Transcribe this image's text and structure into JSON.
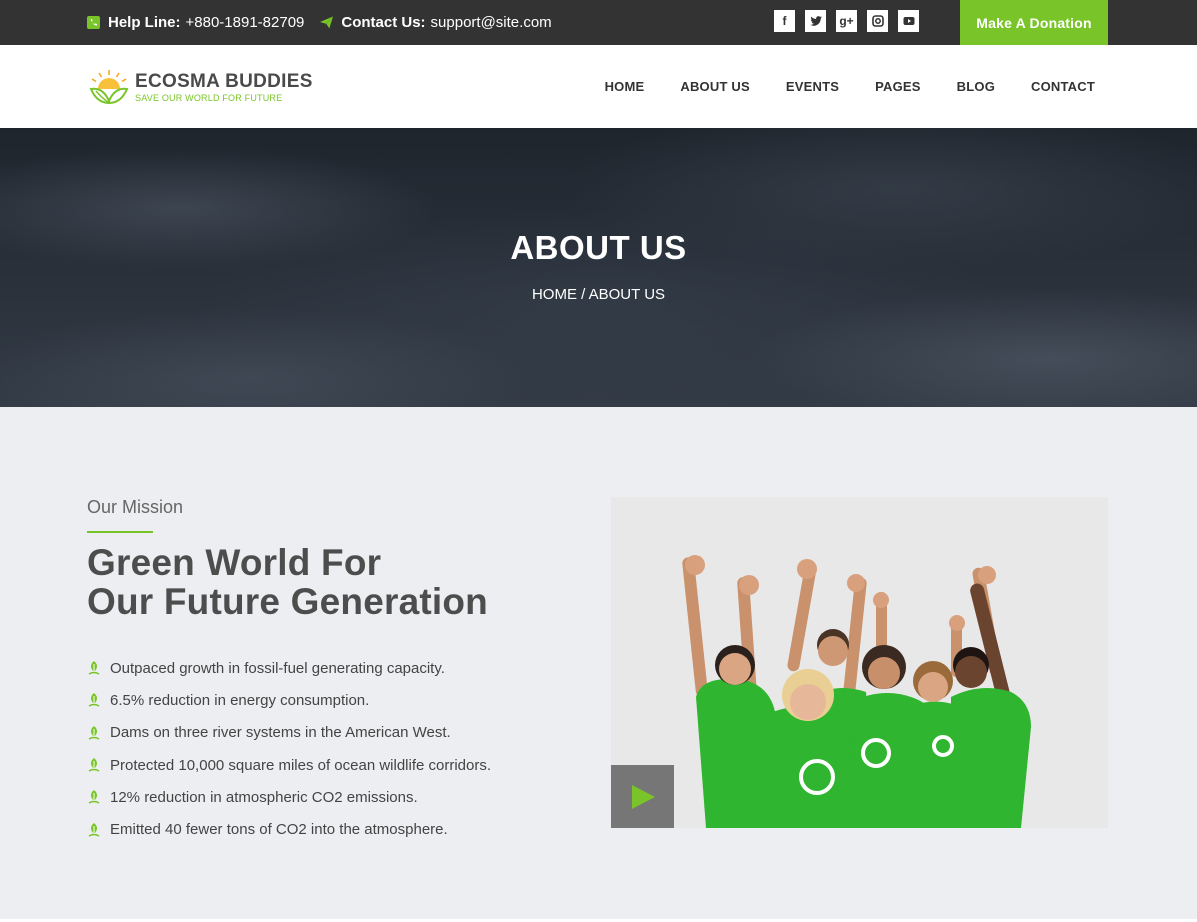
{
  "topbar": {
    "helpline_label": "Help Line:",
    "helpline_value": "+880-1891-82709",
    "contact_label": "Contact Us:",
    "contact_value": "support@site.com",
    "socials": [
      {
        "name": "facebook-icon",
        "glyph": "f"
      },
      {
        "name": "twitter-icon",
        "glyph": "t"
      },
      {
        "name": "google-plus-icon",
        "glyph": "g+"
      },
      {
        "name": "instagram-icon",
        "glyph": "◙"
      },
      {
        "name": "youtube-icon",
        "glyph": "▶"
      }
    ],
    "donate_label": "Make A Donation"
  },
  "header": {
    "logo_name": "ECOSMA BUDDIES",
    "logo_tagline": "SAVE OUR WORLD  FOR FUTURE",
    "nav": [
      "HOME",
      "ABOUT US",
      "EVENTS",
      "PAGES",
      "BLOG",
      "CONTACT"
    ]
  },
  "hero": {
    "title": "ABOUT US",
    "breadcrumb": "HOME / ABOUT US"
  },
  "mission": {
    "kicker": "Our Mission",
    "headline_line1": "Green World For",
    "headline_line2": "Our Future Generation",
    "items": [
      "Outpaced growth in fossil-fuel generating capacity.",
      "6.5% reduction in energy consumption.",
      "Dams on three river systems in the American West.",
      "Protected 10,000 square miles of ocean wildlife corridors.",
      "12% reduction in atmospheric CO2 emissions.",
      "Emitted 40 fewer tons of CO2 into the atmosphere."
    ]
  },
  "colors": {
    "accent": "#79c529",
    "topbar": "#333333",
    "shirt": "#2fb52f"
  }
}
